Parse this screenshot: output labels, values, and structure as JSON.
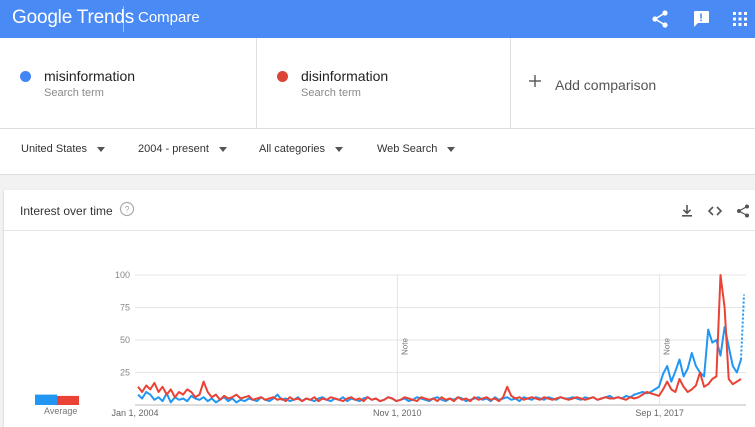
{
  "topbar": {
    "logo": "Google Trends",
    "title": "Compare",
    "icons": [
      "share-icon",
      "feedback-icon",
      "apps-grid-icon"
    ],
    "color": "#4a8af4"
  },
  "terms": [
    {
      "name": "misinformation",
      "sub": "Search term",
      "color": "#4285f4"
    },
    {
      "name": "disinformation",
      "sub": "Search term",
      "color": "#db4437"
    }
  ],
  "add_comparison": "Add comparison",
  "filters": {
    "region": "United States",
    "time": "2004 - present",
    "category": "All categories",
    "search_type": "Web Search"
  },
  "card": {
    "title": "Interest over time",
    "icons": [
      "help-icon",
      "download-icon",
      "embed-icon",
      "share-icon"
    ],
    "average_label": "Average"
  },
  "chart_data": {
    "type": "line",
    "ylim": [
      0,
      100
    ],
    "yticks": [
      "100",
      "75",
      "50",
      "25"
    ],
    "xticks": [
      "Jan 1, 2004",
      "Nov 1, 2010",
      "Sep 1, 2017"
    ],
    "notes": [
      "Note",
      "Note"
    ],
    "averages": [
      {
        "name": "misinformation",
        "value": 8
      },
      {
        "name": "disinformation",
        "value": 7
      }
    ],
    "x_start": "2004-01",
    "x_end": "2019-12",
    "series": [
      {
        "name": "misinformation",
        "color": "#2196f3",
        "values": [
          8,
          5,
          10,
          8,
          4,
          6,
          3,
          9,
          2,
          6,
          4,
          5,
          3,
          7,
          5,
          4,
          6,
          3,
          5,
          2,
          4,
          6,
          3,
          5,
          2,
          4,
          3,
          5,
          4,
          3,
          6,
          4,
          3,
          5,
          8,
          4,
          5,
          3,
          4,
          6,
          3,
          5,
          4,
          3,
          5,
          6,
          4,
          3,
          5,
          4,
          6,
          3,
          5,
          4,
          3,
          5,
          6,
          4,
          5,
          3,
          4,
          6,
          5,
          3,
          4,
          5,
          3,
          4,
          6,
          5,
          4,
          3,
          5,
          6,
          4,
          3,
          5,
          4,
          6,
          5,
          3,
          4,
          5,
          6,
          4,
          5,
          3,
          6,
          4,
          5,
          6,
          4,
          5,
          3,
          6,
          5,
          4,
          6,
          5,
          4,
          6,
          5,
          4,
          6,
          5,
          5,
          6,
          5,
          4,
          6,
          5,
          6,
          4,
          5,
          6,
          7,
          5,
          6,
          5,
          7,
          6,
          8,
          9,
          10,
          9,
          10,
          12,
          14,
          24,
          30,
          18,
          26,
          35,
          22,
          28,
          40,
          30,
          25,
          22,
          58,
          48,
          50,
          38,
          60,
          45,
          30,
          25,
          35
        ]
      },
      {
        "name": "disinformation",
        "color": "#ea4335",
        "values": [
          14,
          10,
          15,
          12,
          17,
          10,
          14,
          8,
          12,
          6,
          10,
          8,
          12,
          10,
          6,
          8,
          18,
          10,
          6,
          8,
          4,
          7,
          5,
          6,
          8,
          5,
          6,
          7,
          4,
          5,
          6,
          4,
          5,
          6,
          4,
          5,
          3,
          6,
          4,
          5,
          3,
          5,
          4,
          6,
          3,
          5,
          4,
          6,
          5,
          4,
          3,
          5,
          6,
          4,
          5,
          3,
          6,
          4,
          5,
          3,
          4,
          6,
          5,
          3,
          4,
          6,
          5,
          4,
          3,
          6,
          5,
          4,
          5,
          3,
          6,
          4,
          5,
          3,
          6,
          4,
          5,
          3,
          6,
          4,
          5,
          6,
          4,
          5,
          3,
          6,
          14,
          7,
          5,
          6,
          4,
          5,
          6,
          5,
          4,
          6,
          5,
          4,
          5,
          6,
          5,
          4,
          5,
          6,
          5,
          4,
          5,
          6,
          4,
          5,
          6,
          5,
          5,
          6,
          5,
          4,
          6,
          5,
          6,
          8,
          10,
          9,
          8,
          7,
          12,
          18,
          12,
          10,
          20,
          14,
          10,
          12,
          15,
          25,
          14,
          16,
          20,
          22,
          100,
          75,
          20,
          16,
          18,
          20
        ]
      }
    ]
  }
}
